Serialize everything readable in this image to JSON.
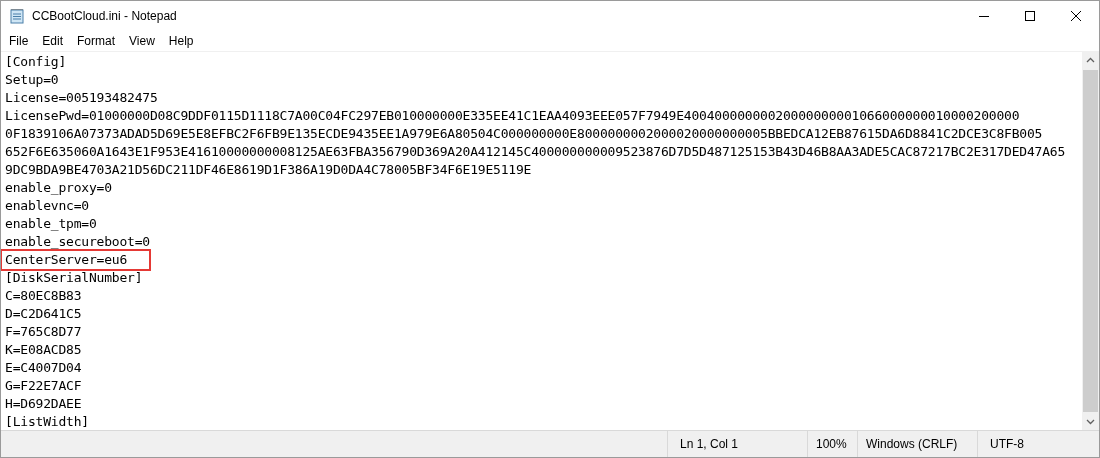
{
  "window": {
    "title": "CCBootCloud.ini - Notepad"
  },
  "menu": [
    "File",
    "Edit",
    "Format",
    "View",
    "Help"
  ],
  "lines": [
    {
      "text": "[Config]",
      "highlighted": false
    },
    {
      "text": "Setup=0",
      "highlighted": false
    },
    {
      "text": "License=005193482475",
      "highlighted": false
    },
    {
      "text": "LicensePwd=01000000D08C9DDF0115D1118C7A00C04FC297EB010000000E335EE41C1EAA4093EEE057F7949E40040000000020000000001066000000010000200000",
      "highlighted": false
    },
    {
      "text": "0F1839106A07373ADAD5D69E5E8EFBC2F6FB9E135ECDE9435EE1A979E6A80504C000000000E8000000002000020000000005BBEDCA12EB87615DA6D8841C2DCE3C8FB005",
      "highlighted": false
    },
    {
      "text": "652F6E635060A1643E1F953E41610000000008125AE63FBA356790D369A20A412145C400000000009523876D7D5D487125153B43D46B8AA3ADE5CAC87217BC2E317DED47A65",
      "highlighted": false
    },
    {
      "text": "9DC9BDA9BE4703A21D56DC211DF46E8619D1F386A19D0DA4C78005BF34F6E19E5119E",
      "highlighted": false
    },
    {
      "text": "enable_proxy=0",
      "highlighted": false
    },
    {
      "text": "enablevnc=0",
      "highlighted": false
    },
    {
      "text": "enable_tpm=0",
      "highlighted": false
    },
    {
      "text": "enable_secureboot=0",
      "highlighted": false
    },
    {
      "text": "CenterServer=eu6",
      "highlighted": true
    },
    {
      "text": "[DiskSerialNumber]",
      "highlighted": false
    },
    {
      "text": "C=80EC8B83",
      "highlighted": false
    },
    {
      "text": "D=C2D641C5",
      "highlighted": false
    },
    {
      "text": "F=765C8D77",
      "highlighted": false
    },
    {
      "text": "K=E08ACD85",
      "highlighted": false
    },
    {
      "text": "E=C4007D04",
      "highlighted": false
    },
    {
      "text": "G=F22E7ACF",
      "highlighted": false
    },
    {
      "text": "H=D692DAEE",
      "highlighted": false
    },
    {
      "text": "[ListWidth]",
      "highlighted": false
    }
  ],
  "status_bar": {
    "position": "Ln 1, Col 1",
    "zoom": "100%",
    "line_endings": "Windows (CRLF)",
    "encoding": "UTF-8"
  }
}
